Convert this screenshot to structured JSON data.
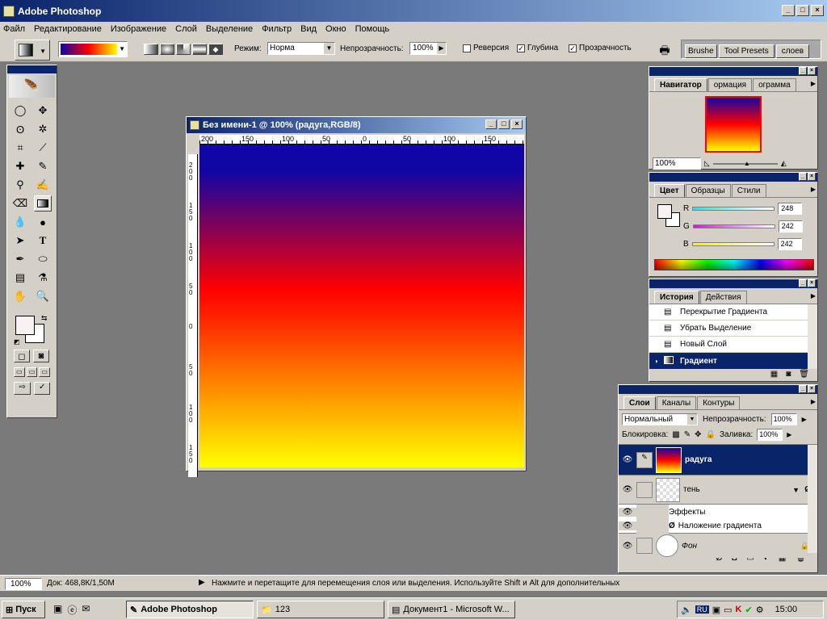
{
  "app": {
    "title": "Adobe Photoshop"
  },
  "menu": [
    "Файл",
    "Редактирование",
    "Изображение",
    "Слой",
    "Выделение",
    "Фильтр",
    "Вид",
    "Окно",
    "Помощь"
  ],
  "options": {
    "mode_label": "Режим:",
    "mode_value": "Норма",
    "opacity_label": "Непрозрачность:",
    "opacity_value": "100%",
    "reverse_label": "Реверсия",
    "dither_label": "Глубина",
    "transparency_label": "Прозрачность",
    "well_tabs": [
      "Brushe",
      "Tool Presets",
      "слоев"
    ]
  },
  "document": {
    "title": "Без имени-1 @ 100% (радуга,RGB/8)",
    "gradient_colors": [
      "#1006a6",
      "#ff0000",
      "#ffff00"
    ],
    "ruler_h": [
      "200",
      "150",
      "100",
      "50",
      "0",
      "50",
      "100",
      "150"
    ],
    "ruler_v": [
      "2 0 0",
      "1 5 0",
      "1 0 0",
      "5 0",
      "0",
      "5 0",
      "1 0 0",
      "1 5 0"
    ]
  },
  "navigator": {
    "tabs": [
      "Навигатор",
      "ормация",
      "ограмма"
    ],
    "zoom": "100%"
  },
  "color": {
    "tabs": [
      "Цвет",
      "Образцы",
      "Стили"
    ],
    "channels": [
      {
        "name": "R",
        "value": "248"
      },
      {
        "name": "G",
        "value": "242"
      },
      {
        "name": "B",
        "value": "242"
      }
    ]
  },
  "history": {
    "tabs": [
      "История",
      "Действия"
    ],
    "items": [
      "Перекрытие Градиента",
      "Убрать Выделение",
      "Новый Слой",
      "Градиент"
    ]
  },
  "layers": {
    "tabs": [
      "Слои",
      "Каналы",
      "Контуры"
    ],
    "blend": "Нормальный",
    "opacity_label": "Непрозрачность:",
    "opacity_value": "100%",
    "lock_label": "Блокировка:",
    "fill_label": "Заливка:",
    "fill_value": "100%",
    "items": [
      {
        "name": "радуга"
      },
      {
        "name": "тень"
      },
      {
        "name": "Эффекты"
      },
      {
        "name": "Наложение градиента"
      },
      {
        "name": "Фон"
      }
    ]
  },
  "status": {
    "zoom": "100%",
    "doc": "Док: 468,8К/1,50М",
    "hint": "Нажмите и перетащите для перемещения слоя или выделения. Используйте Shift и Alt для дополнительных"
  },
  "taskbar": {
    "start": "Пуск",
    "tasks": [
      "Adobe Photoshop",
      "123",
      "Документ1 - Microsoft W..."
    ],
    "lang": "RU",
    "clock": "15:00"
  }
}
